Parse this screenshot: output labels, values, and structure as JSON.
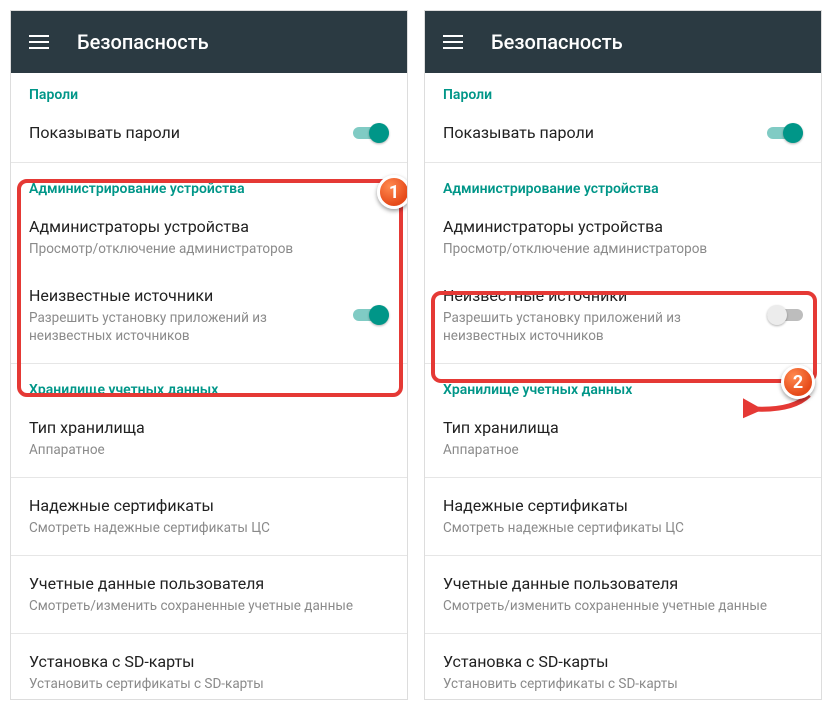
{
  "appbar": {
    "title": "Безопасность"
  },
  "sections": {
    "passwords": "Пароли",
    "device_admin": "Администрирование устройства",
    "cred_storage": "Хранилище учетных данных"
  },
  "items": {
    "show_passwords": {
      "title": "Показывать пароли"
    },
    "device_admins": {
      "title": "Администраторы устройства",
      "sub": "Просмотр/отключение администраторов"
    },
    "unknown_sources": {
      "title": "Неизвестные источники",
      "sub": "Разрешить установку приложений из неизвестных источников"
    },
    "storage_type": {
      "title": "Тип хранилища",
      "sub": "Аппаратное"
    },
    "trusted_certs": {
      "title": "Надежные сертификаты",
      "sub": "Смотреть надежные сертификаты ЦС"
    },
    "user_creds": {
      "title": "Учетные данные пользователя",
      "sub": "Смотреть/изменить сохраненные учетные данные"
    },
    "install_sd": {
      "title": "Установка с SD-карты",
      "sub": "Установить сертификаты с SD-карты"
    }
  },
  "callouts": {
    "one": "1",
    "two": "2"
  },
  "toggles": {
    "left_show_passwords": true,
    "left_unknown_sources": true,
    "right_show_passwords": true,
    "right_unknown_sources": false
  }
}
